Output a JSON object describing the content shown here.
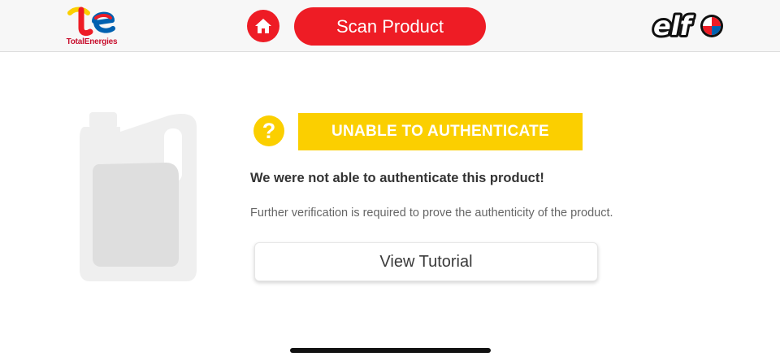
{
  "header": {
    "brand_left": {
      "text": "TotalEnergies",
      "icon": "totalenergies-logo"
    },
    "home": {
      "icon": "home-icon"
    },
    "scan_button_label": "Scan Product",
    "brand_right": {
      "text": "elf",
      "icon": "elf-logo"
    }
  },
  "result": {
    "status_icon": "question-icon",
    "status_glyph": "?",
    "status_label": "UNABLE TO AUTHENTICATE",
    "status_color": "#fbcf00",
    "headline": "We were not able to authenticate this product!",
    "description": "Further verification is required to prove the authenticity of the product.",
    "tutorial_button_label": "View Tutorial"
  },
  "product_image": {
    "icon": "oil-canister-placeholder"
  },
  "colors": {
    "accent_red": "#ee1c25",
    "warning_yellow": "#fbcf00",
    "header_bg": "#f7f7f7"
  }
}
